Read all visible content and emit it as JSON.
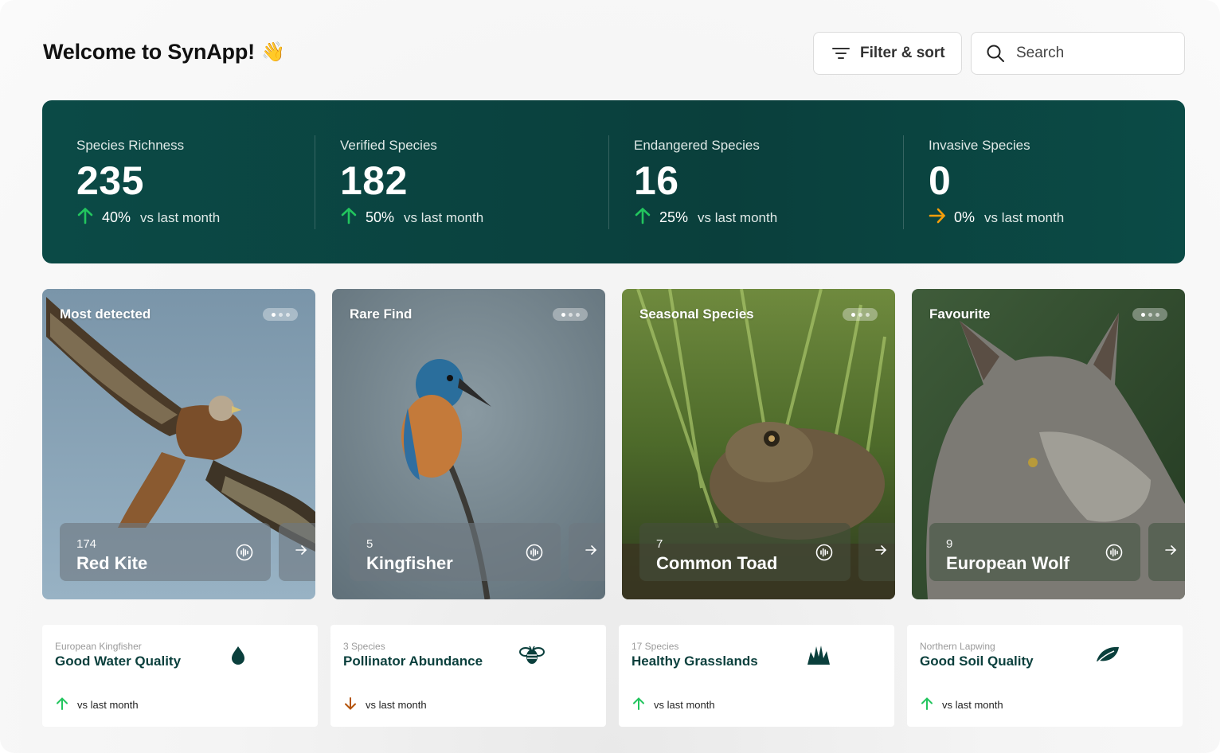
{
  "header": {
    "title": "Welcome to SynApp!",
    "wave_emoji": "👋",
    "filter_label": "Filter & sort",
    "search_placeholder": "Search"
  },
  "stats": [
    {
      "label": "Species Richness",
      "value": "235",
      "change": "40%",
      "trend": "up",
      "period": "vs last month"
    },
    {
      "label": "Verified Species",
      "value": "182",
      "change": "50%",
      "trend": "up",
      "period": "vs last month"
    },
    {
      "label": "Endangered Species",
      "value": "16",
      "change": "25%",
      "trend": "up",
      "period": "vs last month"
    },
    {
      "label": "Invasive Species",
      "value": "0",
      "change": "0%",
      "trend": "flat",
      "period": "vs last month"
    }
  ],
  "cards": [
    {
      "tag": "Most detected",
      "count": "174",
      "name": "Red Kite",
      "image": "red-kite-photo"
    },
    {
      "tag": "Rare Find",
      "count": "5",
      "name": "Kingfisher",
      "image": "kingfisher-photo"
    },
    {
      "tag": "Seasonal Species",
      "count": "7",
      "name": "Common Toad",
      "image": "common-toad-photo"
    },
    {
      "tag": "Favourite",
      "count": "9",
      "name": "European Wolf",
      "image": "european-wolf-photo"
    }
  ],
  "metrics": [
    {
      "sub": "European Kingfisher",
      "title": "Good Water Quality",
      "icon": "water-drop-icon",
      "trend": "up",
      "period": "vs last month"
    },
    {
      "sub": "3 Species",
      "title": "Pollinator Abundance",
      "icon": "bee-icon",
      "trend": "down",
      "period": "vs last month"
    },
    {
      "sub": "17 Species",
      "title": "Healthy Grasslands",
      "icon": "grass-icon",
      "trend": "up",
      "period": "vs last month"
    },
    {
      "sub": "Northern Lapwing",
      "title": "Good Soil Quality",
      "icon": "leaf-icon",
      "trend": "up",
      "period": "vs last month"
    }
  ],
  "colors": {
    "banner": "#0a3f3c",
    "trend_up": "#22c55e",
    "trend_flat": "#f59e0b",
    "trend_down": "#b45309",
    "accent_text": "#0a3f3c"
  }
}
